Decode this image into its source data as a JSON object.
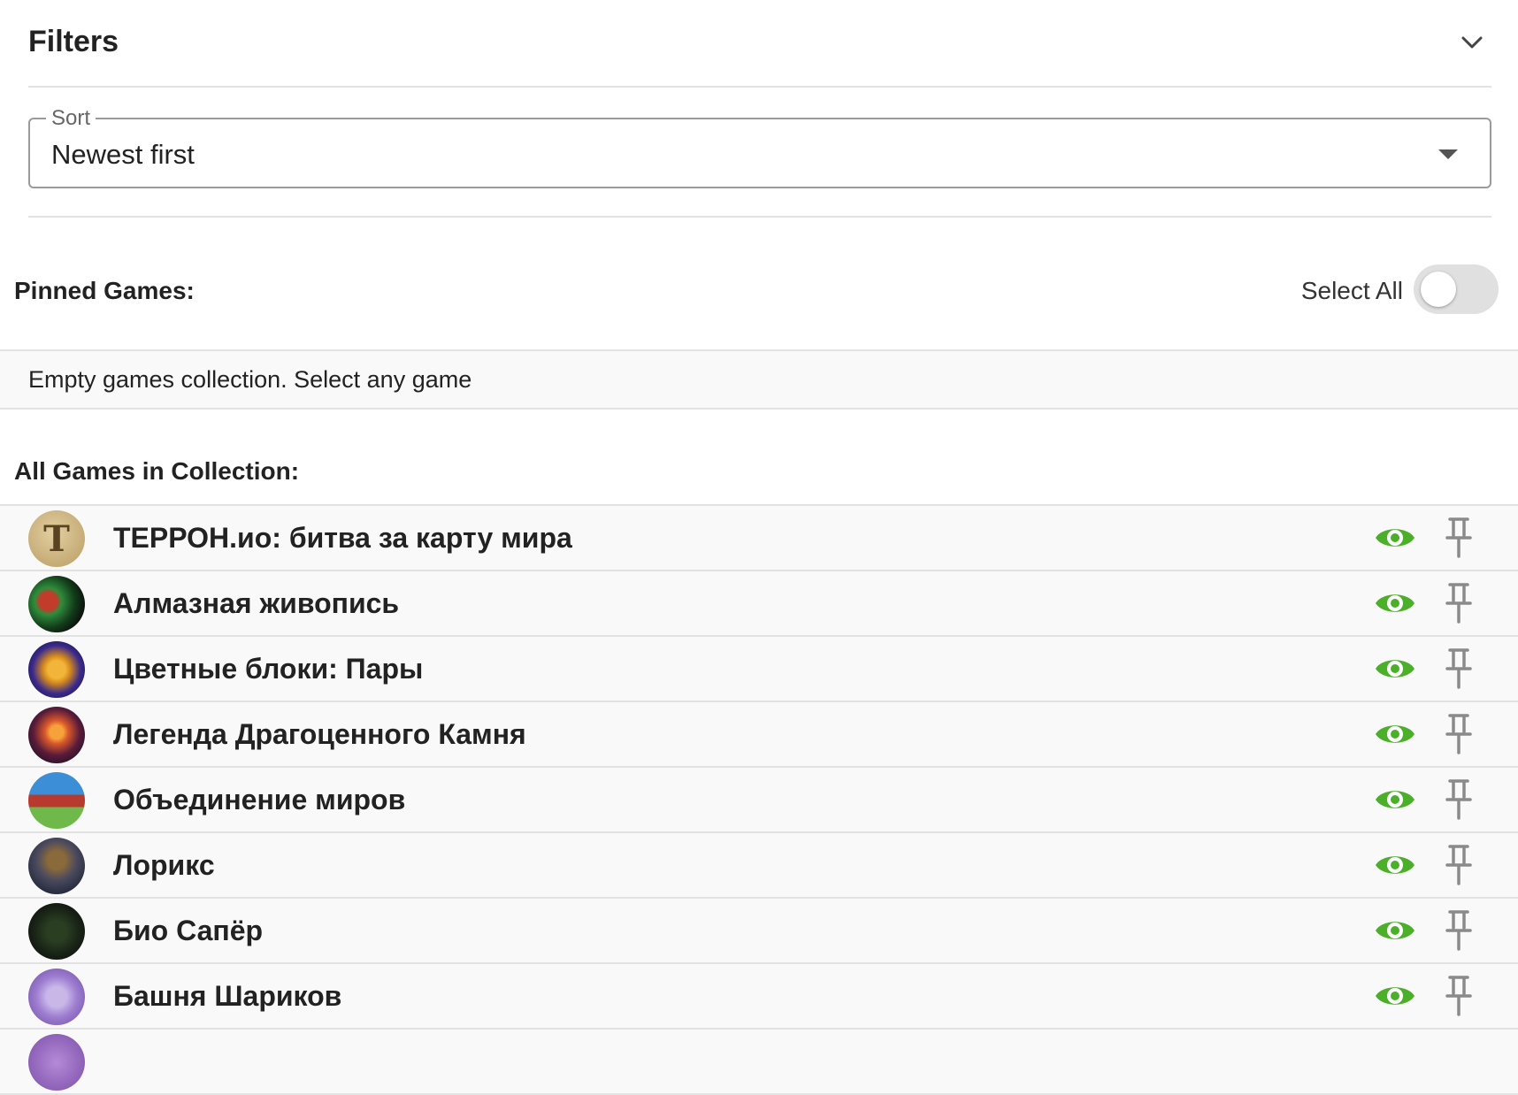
{
  "filters": {
    "title": "Filters",
    "icon": "chevron-down-icon"
  },
  "sort": {
    "label": "Sort",
    "value": "Newest first"
  },
  "pinned": {
    "title": "Pinned Games:",
    "select_all_label": "Select All",
    "select_all_on": false,
    "empty_text": "Empty games collection. Select any game"
  },
  "all_games": {
    "title": "All Games in Collection:",
    "items": [
      {
        "name": "ТЕРРОН.ио: битва за карту мира",
        "icon": "terron-game-icon"
      },
      {
        "name": "Алмазная живопись",
        "icon": "diamond-painting-game-icon"
      },
      {
        "name": "Цветные блоки: Пары",
        "icon": "color-blocks-game-icon"
      },
      {
        "name": "Легенда Драгоценного Камня",
        "icon": "gem-legend-game-icon"
      },
      {
        "name": "Объединение миров",
        "icon": "merge-worlds-game-icon"
      },
      {
        "name": "Лорикс",
        "icon": "loriks-game-icon"
      },
      {
        "name": "Био Сапёр",
        "icon": "bio-sapper-game-icon"
      },
      {
        "name": "Башня Шариков",
        "icon": "ball-tower-game-icon"
      }
    ]
  },
  "colors": {
    "eye": "#4caf2a",
    "pin": "#8a8a8a",
    "row_bg": "#f9f9f9",
    "divider": "#e2e2e2"
  }
}
